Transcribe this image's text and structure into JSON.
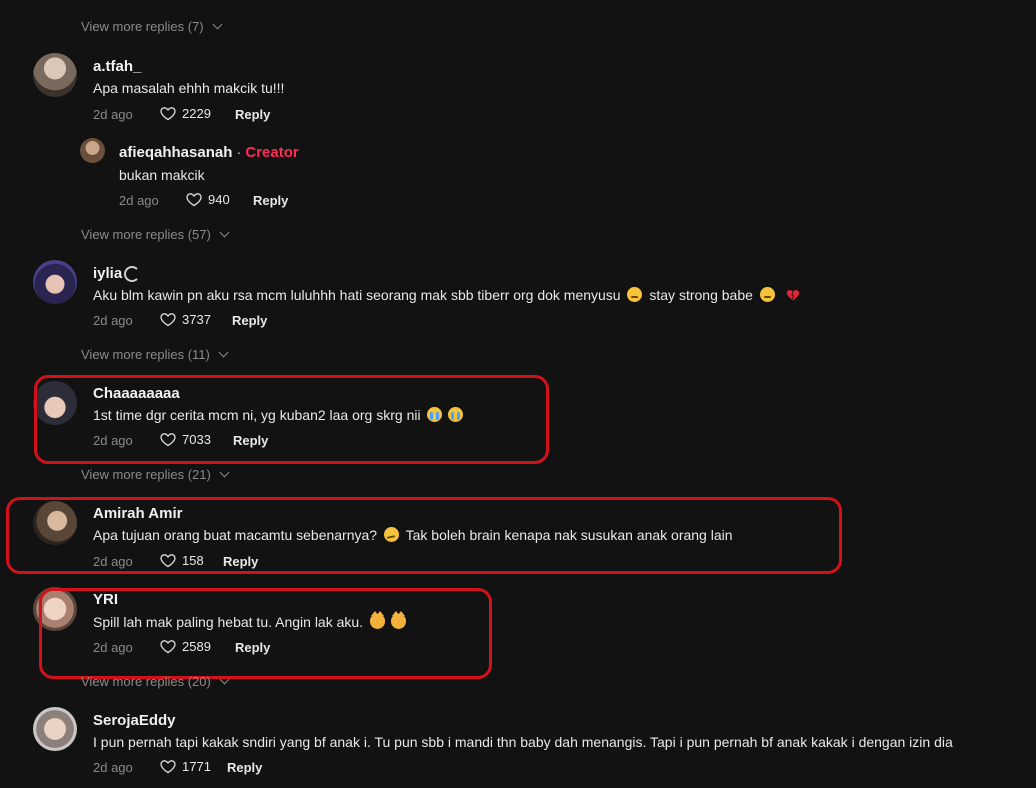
{
  "view_more": [
    "View more replies (7)",
    "View more replies (57)",
    "View more replies (11)",
    "View more replies (21)",
    "View more replies (20)"
  ],
  "comments": [
    {
      "username": "a.tfah_",
      "text": "Apa masalah ehhh makcik tu!!!",
      "time": "2d ago",
      "likes": "2229",
      "reply": "Reply"
    },
    {
      "username": "afieqahhasanah",
      "separator": "·",
      "badge": "Creator",
      "text": "bukan makcik",
      "time": "2d ago",
      "likes": "940",
      "reply": "Reply"
    },
    {
      "username": "iylia",
      "text": "Aku blm kawin pn aku rsa mcm luluhhh hati seorang mak sbb tiberr org dok menyusu",
      "text2": "stay strong babe",
      "time": "2d ago",
      "likes": "3737",
      "reply": "Reply"
    },
    {
      "username": "Chaaaaaaaa",
      "text": "1st time dgr cerita mcm ni, yg kuban2 laa org skrg nii",
      "time": "2d ago",
      "likes": "7033",
      "reply": "Reply"
    },
    {
      "username": "Amirah Amir",
      "text": "Apa tujuan orang buat macamtu sebenarnya?",
      "text2": "Tak boleh brain kenapa nak susukan anak orang lain",
      "time": "2d ago",
      "likes": "158",
      "reply": "Reply"
    },
    {
      "username": "YRI",
      "text": "Spill lah mak paling hebat tu. Angin lak aku.",
      "time": "2d ago",
      "likes": "2589",
      "reply": "Reply"
    },
    {
      "username": "SerojaEddy",
      "text": "I pun pernah tapi kakak sndiri yang bf anak i. Tu pun sbb i mandi thn baby dah menangis. Tapi i pun pernah bf anak kakak i dengan izin dia",
      "time": "2d ago",
      "likes": "1771",
      "reply": "Reply"
    }
  ],
  "icons": {
    "like": "heart-outline-icon",
    "chevron": "chevron-down-icon"
  },
  "colors": {
    "background": "#121212",
    "creator": "#fe2c55",
    "highlight": "#d3111a",
    "muted": "#8a8a8a"
  }
}
